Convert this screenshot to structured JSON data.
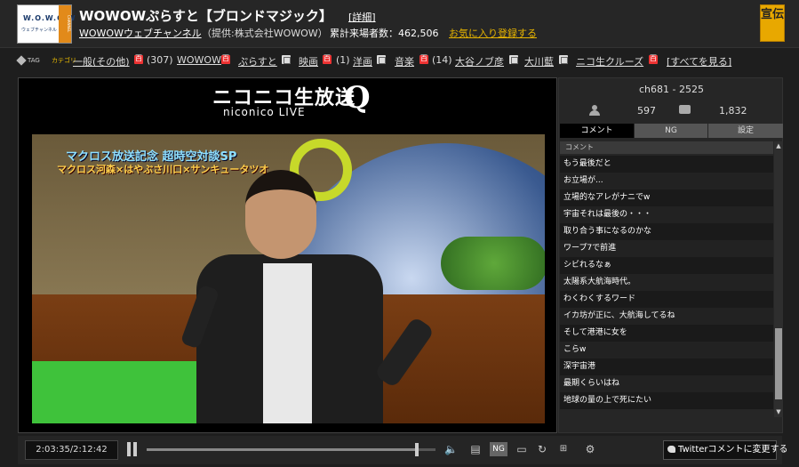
{
  "header": {
    "logo_text": "W.O.W.O.W",
    "logo_sub": "ウェブチャンネル",
    "logo_tag": "CHANNEL",
    "title": "WOWOWぷらすと【ブロンドマジック】",
    "detail_link": "[詳細]",
    "channel_link": "WOWOWウェブチャンネル",
    "provider": "（提供:株式会社WOWOW）",
    "visitors": "累計来場者数：462,506",
    "favorite_link": "お気に入り登録する",
    "ad_button": "宣伝"
  },
  "tags": {
    "tag_label": "TAG",
    "category_label": "カテゴリ",
    "items": [
      {
        "label": "一般(その他)",
        "count": "(307)"
      },
      {
        "label": "WOWOW"
      },
      {
        "label": "ぷらすと"
      },
      {
        "label": "映画",
        "count": "(1)"
      },
      {
        "label": "洋画"
      },
      {
        "label": "音楽",
        "count": "(14)"
      },
      {
        "label": "大谷ノブ彦"
      },
      {
        "label": "大川藍"
      },
      {
        "label": "ニコ生クルーズ"
      },
      {
        "label": "[すべてを見る]"
      }
    ]
  },
  "player": {
    "nico_logo": "ニコニコ生放送",
    "nico_live": "niconico LIVE",
    "nico_q": "Q",
    "caption_top": "マクロス放送記念 超時空対談SP",
    "caption_bottom": "マクロス河森×はやぶさ川口×サンキュータツオ"
  },
  "controls": {
    "time": "2:03:35/2:12:42",
    "progress": 0.934,
    "twitter_button": "Twitterコメントに変更する"
  },
  "side": {
    "channel_id": "ch681 - 2525",
    "viewers": "597",
    "comments": "1,832",
    "tabs": [
      "コメント",
      "NG",
      "設定"
    ],
    "comment_header": "コメント",
    "comment_rows": [
      "もう最後だと",
      "お立場が...",
      "立場的なアレがナニでw",
      "宇宙それは最後の・・・",
      "取り合う事になるのかな",
      "ワープ7で前進",
      "シビれるなぁ",
      "太陽系大航海時代。",
      "わくわくするワード",
      "イカ坊が正に、大航海してるね",
      "そして港港に女を",
      "こらw",
      "深宇宙港",
      "最期くらいはね",
      "地球の量の上で死にたい"
    ]
  }
}
